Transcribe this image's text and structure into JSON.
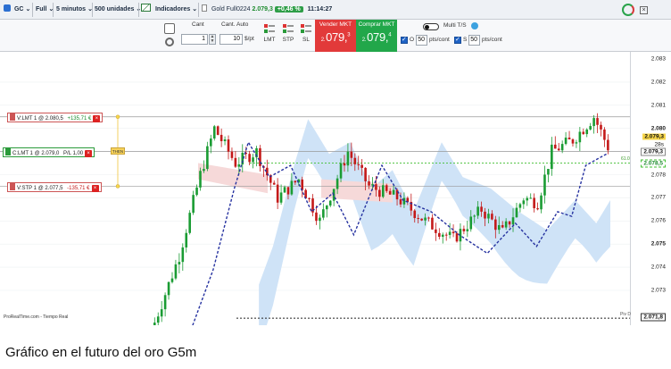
{
  "toolbar": {
    "instrument": "GC",
    "style": "Full",
    "period": "5 minutos",
    "units": "500 unidades",
    "indicators": "Indicadores",
    "ticker": "Gold Full0224",
    "price": "2.079,3",
    "change": "+0,46 %",
    "time": "11:14:27"
  },
  "order_panel": {
    "cant_label": "Cant",
    "cant_value": "1",
    "cant_auto_label": "Cant. Auto",
    "cant_auto_value": "10",
    "cant_auto_unit": "$/pt",
    "lmt_label": "LMT",
    "stp_label": "STP",
    "sl_label": "SL",
    "sell_title": "Vender MKT",
    "sell_prefix": "2.",
    "sell_main": "079,",
    "sell_sup": "3",
    "buy_title": "Comprar MKT",
    "buy_prefix": "2.",
    "buy_main": "079,",
    "buy_sup": "4",
    "multi_label": "Multi T/S",
    "o_label": "O",
    "o_value": "50",
    "o_unit": "pts/cont",
    "s_label": "S",
    "s_value": "50",
    "s_unit": "pts/cont"
  },
  "orders": {
    "sell_limit": "V:LMT  1  @  2.080,5",
    "sell_limit_pl": "+135,71 €",
    "position": "C:LMT  1  @  2.079,0",
    "position_pl": "P/L  1,00",
    "stop": "V:STP  1  @  2.077,5",
    "stop_pl": "-135,71 €",
    "then": "THEN"
  },
  "price_axis": {
    "ticks": [
      "2.083",
      "2.082",
      "2.081",
      "2.080",
      "2.079",
      "2.078",
      "2.077",
      "2.076",
      "2.075",
      "2.074",
      "2.073"
    ],
    "current_price": "2.079,3",
    "tag_top": "2.079,3",
    "tag_green": "2.078,5",
    "tag_bottom": "2.071,8",
    "tag_mid": "28s"
  },
  "chart_labels": {
    "source": "ProRealTime.com - Tiempo Real",
    "pivot": "Piv D",
    "diag_label": "61.0"
  },
  "caption": "Gráfico en el futuro del oro G5m",
  "colors": {
    "bull": "#1a9c33",
    "bear": "#c41a1a",
    "kijun": "#2632a0",
    "cloud": "#cfe3f7",
    "cloud_red": "#f6d9d9",
    "green_line": "#3fbf2f"
  }
}
